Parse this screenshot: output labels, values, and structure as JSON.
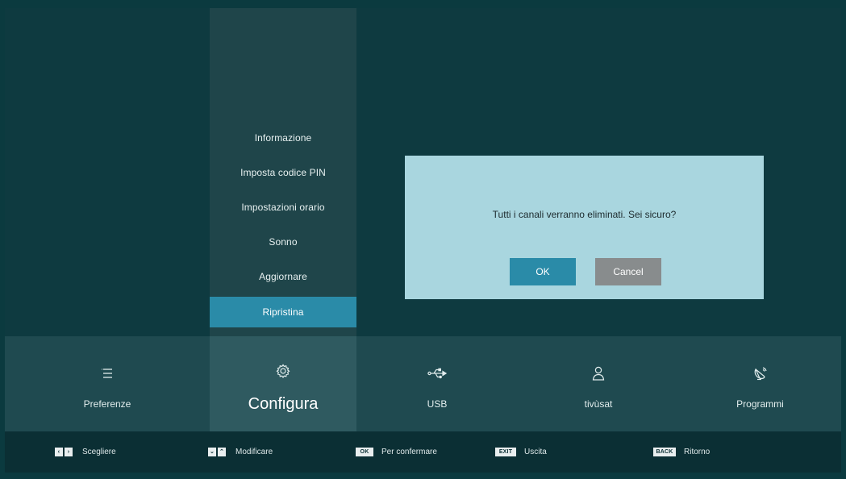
{
  "submenu": {
    "items": [
      {
        "label": "Informazione"
      },
      {
        "label": "Imposta codice PIN"
      },
      {
        "label": "Impostazioni orario"
      },
      {
        "label": "Sonno"
      },
      {
        "label": "Aggiornare"
      },
      {
        "label": "Ripristina",
        "selected": true
      }
    ]
  },
  "dialog": {
    "message": "Tutti i canali verranno eliminati. Sei sicuro?",
    "ok_label": "OK",
    "cancel_label": "Cancel"
  },
  "categories": [
    {
      "label": "Preferenze",
      "icon": "list-icon"
    },
    {
      "label": "Configura",
      "icon": "gear-icon",
      "active": true
    },
    {
      "label": "USB",
      "icon": "usb-icon"
    },
    {
      "label": "tivùsat",
      "icon": "person-icon"
    },
    {
      "label": "Programmi",
      "icon": "satellite-dish-icon"
    }
  ],
  "hints": [
    {
      "keys": [
        "‹",
        "›"
      ],
      "label": "Scegliere"
    },
    {
      "keys": [
        "⌄",
        "⌃"
      ],
      "label": "Modificare"
    },
    {
      "key": "OK",
      "label": "Per confermare"
    },
    {
      "key": "EXIT",
      "label": "Uscita"
    },
    {
      "key": "BACK",
      "label": "Ritorno"
    }
  ],
  "colors": {
    "background": "#0e3a40",
    "submenu_bg": "#1f454a",
    "accent": "#2a8ba8",
    "dialog_bg": "#a9d6df",
    "cancel_bg": "#888c8d",
    "category_bar": "#1f4a50",
    "footer_bg": "#0b2f34"
  }
}
